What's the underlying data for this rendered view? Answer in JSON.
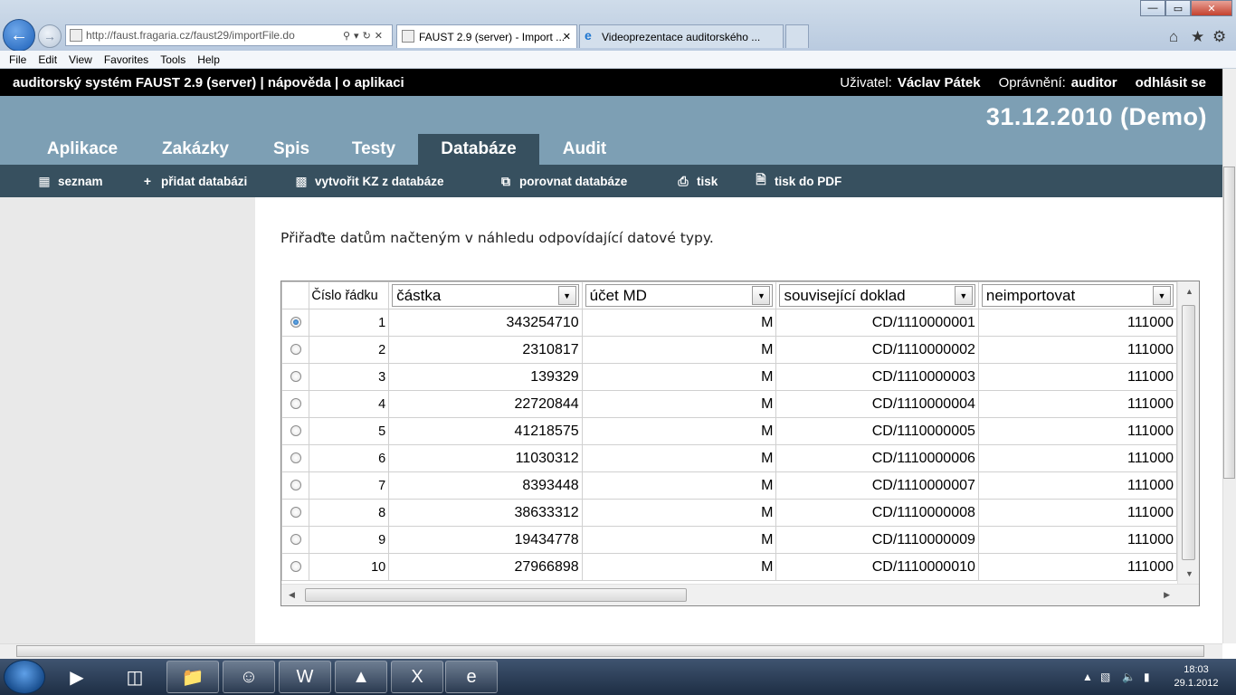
{
  "browser": {
    "url": "http://faust.fragaria.cz/faust29/importFile.do",
    "tabs": [
      {
        "label": "FAUST 2.9 (server) - Import ..."
      },
      {
        "label": "Videoprezentace auditorského ..."
      }
    ],
    "menu": [
      "File",
      "Edit",
      "View",
      "Favorites",
      "Tools",
      "Help"
    ]
  },
  "app": {
    "title": "auditorský systém FAUST 2.9 (server) | nápověda | o aplikaci",
    "user_label": "Uživatel:",
    "user_name": "Václav Pátek",
    "role_label": "Oprávnění:",
    "role": "auditor",
    "logout": "odhlásit se",
    "date": "31.12.2010 (Demo)"
  },
  "main_tabs": [
    "Aplikace",
    "Zakázky",
    "Spis",
    "Testy",
    "Databáze",
    "Audit"
  ],
  "active_tab": "Databáze",
  "sub_nav": [
    {
      "label": "seznam",
      "icon": "list-icon"
    },
    {
      "label": "přidat databázi",
      "icon": "plus-icon"
    },
    {
      "label": "vytvořit KZ z databáze",
      "icon": "bar-chart-icon"
    },
    {
      "label": "porovnat databáze",
      "icon": "compare-icon"
    },
    {
      "label": "tisk",
      "icon": "printer-icon"
    },
    {
      "label": "tisk do PDF",
      "icon": "document-icon"
    }
  ],
  "instruction": "Přiřaďte datům načteným v náhledu odpovídající datové typy.",
  "grid": {
    "row_number_header": "Číslo řádku",
    "column_types": [
      "částka",
      "účet MD",
      "související doklad",
      "neimportovat"
    ],
    "rows": [
      {
        "n": "1",
        "amount": "343254710",
        "acct": "M",
        "doc": "CD/1110000001",
        "extra": "111000"
      },
      {
        "n": "2",
        "amount": "2310817",
        "acct": "M",
        "doc": "CD/1110000002",
        "extra": "111000"
      },
      {
        "n": "3",
        "amount": "139329",
        "acct": "M",
        "doc": "CD/1110000003",
        "extra": "111000"
      },
      {
        "n": "4",
        "amount": "22720844",
        "acct": "M",
        "doc": "CD/1110000004",
        "extra": "111000"
      },
      {
        "n": "5",
        "amount": "41218575",
        "acct": "M",
        "doc": "CD/1110000005",
        "extra": "111000"
      },
      {
        "n": "6",
        "amount": "11030312",
        "acct": "M",
        "doc": "CD/1110000006",
        "extra": "111000"
      },
      {
        "n": "7",
        "amount": "8393448",
        "acct": "M",
        "doc": "CD/1110000007",
        "extra": "111000"
      },
      {
        "n": "8",
        "amount": "38633312",
        "acct": "M",
        "doc": "CD/1110000008",
        "extra": "111000"
      },
      {
        "n": "9",
        "amount": "19434778",
        "acct": "M",
        "doc": "CD/1110000009",
        "extra": "111000"
      },
      {
        "n": "10",
        "amount": "27966898",
        "acct": "M",
        "doc": "CD/1110000010",
        "extra": "111000"
      }
    ],
    "selected_row": 0
  },
  "taskbar": {
    "time": "18:03",
    "date": "29.1.2012"
  },
  "colors": {
    "header_bg": "#7d9fb4",
    "subnav_bg": "#37505f",
    "title_bg": "#000000"
  }
}
